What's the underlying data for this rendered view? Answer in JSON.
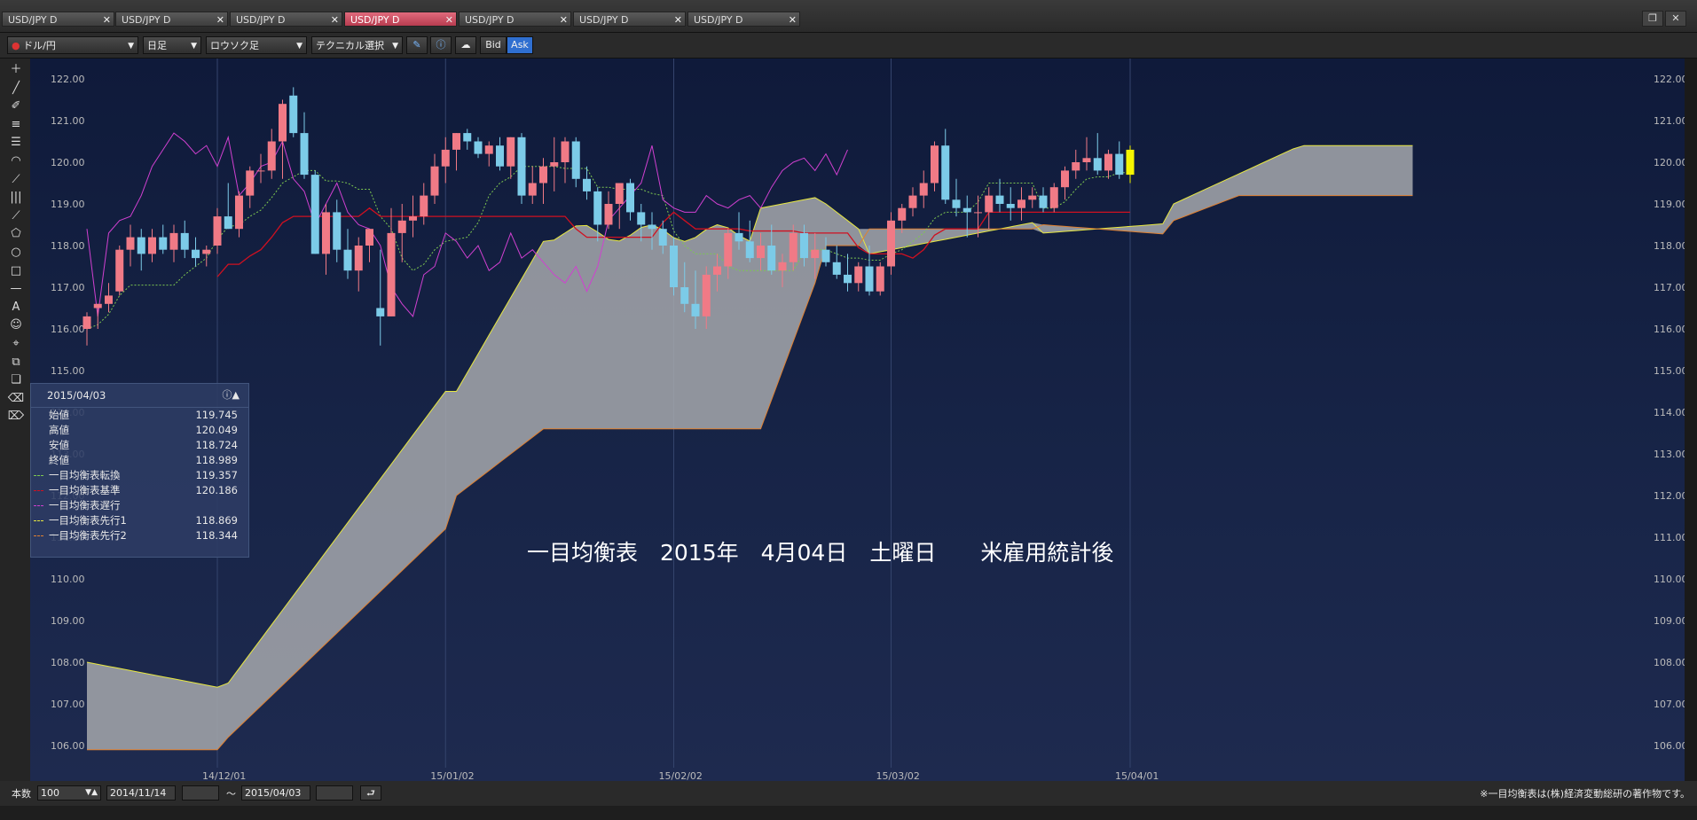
{
  "tabs": [
    {
      "label": "USD/JPY D",
      "active": false
    },
    {
      "label": "USD/JPY D",
      "active": false
    },
    {
      "label": "USD/JPY D",
      "active": false
    },
    {
      "label": "USD/JPY D",
      "active": true
    },
    {
      "label": "USD/JPY D",
      "active": false
    },
    {
      "label": "USD/JPY D",
      "active": false
    },
    {
      "label": "USD/JPY D",
      "active": false
    }
  ],
  "toolbar": {
    "currency": "ドル/円",
    "period": "日足",
    "chart_style": "ロウソク足",
    "technical": "テクニカル選択",
    "bid": "Bid",
    "ask": "Ask"
  },
  "tools": [
    "crosshair-icon",
    "trendline-icon",
    "ruler-icon",
    "parallel-lines-icon",
    "fib-retracement-icon",
    "fib-arc-icon",
    "fib-fan-icon",
    "fib-timezone-icon",
    "gann-icon",
    "pentagon-icon",
    "circle-icon",
    "rectangle-icon",
    "hline-icon",
    "text-icon",
    "icon-insert-icon",
    "magnet-icon",
    "copy-icon",
    "paste-icon",
    "eraser-icon",
    "eraser-all-icon"
  ],
  "info": {
    "date": "2015/04/03",
    "rows": [
      {
        "label": "始値",
        "value": "119.745",
        "color": ""
      },
      {
        "label": "高値",
        "value": "120.049",
        "color": ""
      },
      {
        "label": "安値",
        "value": "118.724",
        "color": ""
      },
      {
        "label": "終値",
        "value": "118.989",
        "color": ""
      },
      {
        "label": "一目均衡表転換",
        "value": "119.357",
        "color": "#7ec850"
      },
      {
        "label": "一目均衡表基準",
        "value": "120.186",
        "color": "#d01020"
      },
      {
        "label": "一目均衡表遅行",
        "value": "",
        "color": "#d040d0"
      },
      {
        "label": "一目均衡表先行1",
        "value": "118.869",
        "color": "#e8e840"
      },
      {
        "label": "一目均衡表先行2",
        "value": "118.344",
        "color": "#e08030"
      }
    ]
  },
  "annotation": "一目均衡表　2015年　4月04日　土曜日　　米雇用統計後",
  "bottom": {
    "count_label": "本数",
    "count_value": "100",
    "from": "2014/11/14",
    "tilde": "〜",
    "to": "2015/04/03",
    "copyright": "※一目均衡表は(株)経済変動総研の著作物です。"
  },
  "chart_data": {
    "type": "candlestick",
    "ylim": [
      105.7,
      122.2
    ],
    "yticks": [
      "122.00",
      "121.00",
      "120.00",
      "119.00",
      "118.00",
      "117.00",
      "116.00",
      "115.00",
      "114.00",
      "113.00",
      "112.00",
      "111.00",
      "110.00",
      "109.00",
      "108.00",
      "107.00",
      "106.00"
    ],
    "xticks": [
      {
        "label": "14/12/01",
        "day": 12
      },
      {
        "label": "15/01/02",
        "day": 33
      },
      {
        "label": "15/02/02",
        "day": 54
      },
      {
        "label": "15/03/02",
        "day": 74
      },
      {
        "label": "15/04/01",
        "day": 96
      }
    ],
    "colors": {
      "up": "#f07a86",
      "down": "#7ccbe8",
      "last": "#f5f500",
      "tenkan": "#7ec850",
      "kijun": "#d01020",
      "chikou": "#d040d0",
      "span1": "#e8e840",
      "span2": "#e08030",
      "cloud": "#a6a8ad"
    },
    "candles": [
      [
        116.0,
        116.4,
        115.6,
        116.3
      ],
      [
        116.5,
        116.6,
        116.0,
        116.6
      ],
      [
        116.6,
        117.1,
        116.4,
        116.8
      ],
      [
        116.9,
        118.0,
        116.8,
        117.9
      ],
      [
        117.9,
        118.5,
        117.5,
        118.2
      ],
      [
        118.2,
        118.4,
        117.4,
        117.8
      ],
      [
        117.8,
        118.4,
        117.6,
        118.2
      ],
      [
        118.2,
        118.5,
        117.8,
        117.9
      ],
      [
        117.9,
        118.5,
        117.6,
        118.3
      ],
      [
        118.3,
        118.6,
        117.7,
        117.9
      ],
      [
        117.9,
        118.2,
        117.5,
        117.7
      ],
      [
        117.8,
        118.0,
        117.5,
        117.9
      ],
      [
        118.0,
        118.9,
        117.8,
        118.7
      ],
      [
        118.7,
        119.5,
        118.4,
        118.4
      ],
      [
        118.4,
        119.3,
        118.2,
        119.2
      ],
      [
        119.2,
        119.9,
        118.9,
        119.8
      ],
      [
        119.8,
        120.2,
        119.5,
        119.8
      ],
      [
        119.8,
        120.8,
        119.6,
        120.5
      ],
      [
        120.5,
        121.5,
        119.6,
        121.4
      ],
      [
        121.6,
        121.8,
        120.6,
        120.7
      ],
      [
        120.7,
        121.2,
        119.6,
        119.7
      ],
      [
        119.7,
        119.8,
        117.8,
        117.8
      ],
      [
        117.8,
        119.0,
        117.3,
        118.8
      ],
      [
        118.8,
        119.1,
        117.6,
        117.9
      ],
      [
        117.9,
        118.4,
        117.2,
        117.4
      ],
      [
        117.4,
        118.2,
        116.9,
        118.0
      ],
      [
        118.0,
        118.4,
        117.6,
        118.4
      ],
      [
        116.5,
        117.9,
        115.6,
        116.3
      ],
      [
        116.3,
        118.9,
        116.3,
        118.3
      ],
      [
        118.3,
        119.0,
        117.6,
        118.6
      ],
      [
        118.6,
        119.2,
        118.2,
        118.7
      ],
      [
        118.7,
        119.5,
        118.5,
        119.2
      ],
      [
        119.2,
        120.2,
        119.0,
        119.9
      ],
      [
        119.9,
        120.6,
        119.5,
        120.3
      ],
      [
        120.3,
        120.7,
        119.8,
        120.7
      ],
      [
        120.7,
        120.8,
        120.3,
        120.5
      ],
      [
        120.5,
        120.6,
        120.1,
        120.2
      ],
      [
        120.2,
        120.5,
        119.9,
        120.4
      ],
      [
        120.4,
        120.6,
        119.8,
        119.9
      ],
      [
        119.9,
        120.6,
        119.6,
        120.6
      ],
      [
        120.6,
        120.7,
        119.0,
        119.2
      ],
      [
        119.2,
        119.9,
        119.0,
        119.5
      ],
      [
        119.5,
        120.1,
        119.0,
        119.9
      ],
      [
        119.9,
        120.6,
        119.3,
        120.0
      ],
      [
        120.0,
        120.6,
        119.5,
        120.5
      ],
      [
        120.5,
        120.6,
        119.4,
        119.6
      ],
      [
        119.6,
        119.9,
        119.1,
        119.3
      ],
      [
        119.3,
        119.4,
        118.1,
        118.5
      ],
      [
        118.5,
        119.3,
        118.4,
        119.0
      ],
      [
        119.0,
        119.5,
        118.4,
        119.5
      ],
      [
        119.5,
        119.6,
        118.6,
        118.8
      ],
      [
        118.8,
        119.0,
        118.1,
        118.5
      ],
      [
        118.5,
        118.8,
        117.9,
        118.4
      ],
      [
        118.4,
        118.6,
        117.8,
        118.0
      ],
      [
        118.0,
        118.2,
        116.8,
        117.0
      ],
      [
        117.0,
        117.6,
        116.4,
        116.6
      ],
      [
        116.6,
        117.4,
        116.0,
        116.3
      ],
      [
        116.3,
        117.5,
        116.0,
        117.3
      ],
      [
        117.3,
        117.8,
        116.9,
        117.5
      ],
      [
        117.5,
        118.4,
        117.2,
        118.3
      ],
      [
        118.3,
        118.8,
        117.9,
        118.1
      ],
      [
        118.1,
        118.6,
        117.6,
        117.7
      ],
      [
        117.7,
        118.3,
        117.4,
        118.0
      ],
      [
        118.0,
        118.5,
        117.3,
        117.4
      ],
      [
        117.4,
        117.8,
        117.0,
        117.6
      ],
      [
        117.6,
        118.5,
        117.4,
        118.3
      ],
      [
        118.3,
        118.5,
        117.5,
        117.7
      ],
      [
        117.7,
        118.3,
        117.2,
        117.9
      ],
      [
        117.9,
        118.2,
        117.5,
        117.6
      ],
      [
        117.6,
        118.0,
        117.2,
        117.3
      ],
      [
        117.3,
        117.8,
        116.9,
        117.1
      ],
      [
        117.1,
        117.6,
        116.9,
        117.5
      ],
      [
        117.5,
        118.0,
        116.8,
        116.9
      ],
      [
        116.9,
        117.6,
        116.8,
        117.5
      ],
      [
        117.5,
        118.8,
        117.3,
        118.6
      ],
      [
        118.6,
        119.0,
        118.3,
        118.9
      ],
      [
        118.9,
        119.4,
        118.7,
        119.2
      ],
      [
        119.2,
        119.8,
        118.9,
        119.5
      ],
      [
        119.5,
        120.5,
        119.3,
        120.4
      ],
      [
        120.4,
        120.8,
        119.0,
        119.1
      ],
      [
        119.1,
        119.6,
        118.7,
        118.9
      ],
      [
        118.9,
        119.2,
        118.2,
        118.8
      ],
      [
        118.8,
        119.2,
        118.2,
        118.8
      ],
      [
        118.8,
        119.4,
        118.4,
        119.2
      ],
      [
        119.2,
        119.6,
        118.8,
        119.0
      ],
      [
        119.0,
        119.4,
        118.6,
        118.9
      ],
      [
        118.9,
        119.4,
        118.6,
        119.1
      ],
      [
        119.1,
        119.4,
        118.9,
        119.2
      ],
      [
        119.2,
        119.4,
        118.8,
        118.9
      ],
      [
        118.9,
        119.5,
        118.8,
        119.4
      ],
      [
        119.4,
        119.9,
        119.1,
        119.8
      ],
      [
        119.8,
        120.3,
        119.6,
        120.0
      ],
      [
        120.0,
        120.6,
        119.8,
        120.1
      ],
      [
        120.1,
        120.7,
        119.7,
        119.8
      ],
      [
        119.8,
        120.3,
        119.6,
        120.2
      ],
      [
        120.2,
        120.5,
        119.6,
        119.7
      ],
      [
        119.7,
        120.4,
        119.5,
        120.3
      ]
    ]
  }
}
